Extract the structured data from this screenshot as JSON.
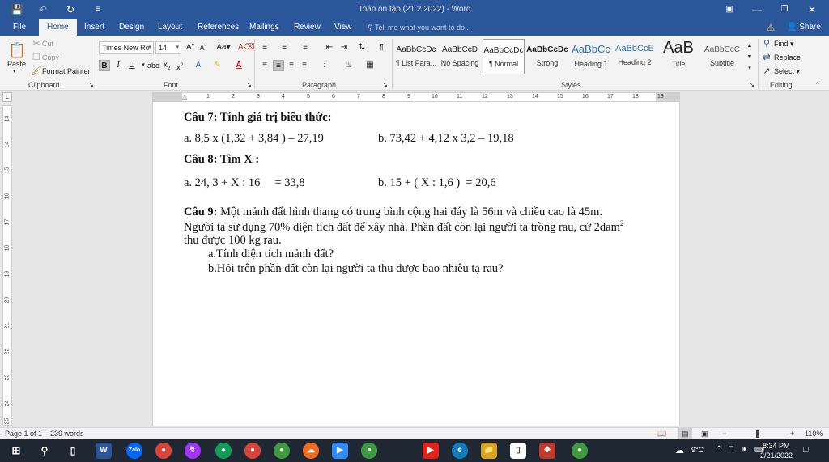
{
  "titlebar": {
    "doc_title": "Toán ôn tập (21.2.2022) - Word",
    "save_icon": "save-icon",
    "undo_icon": "undo-icon",
    "redo_icon": "redo-icon"
  },
  "tabs": [
    {
      "label": "File"
    },
    {
      "label": "Home"
    },
    {
      "label": "Insert"
    },
    {
      "label": "Design"
    },
    {
      "label": "Layout"
    },
    {
      "label": "References"
    },
    {
      "label": "Mailings"
    },
    {
      "label": "Review"
    },
    {
      "label": "View"
    }
  ],
  "tell_me": "Tell me what you want to do...",
  "share_label": "Share",
  "clipboard": {
    "paste": "Paste",
    "cut": "Cut",
    "copy": "Copy",
    "format_painter": "Format Painter",
    "label": "Clipboard"
  },
  "font": {
    "name": "Times New Ro",
    "size": "14",
    "label": "Font"
  },
  "paragraph": {
    "label": "Paragraph"
  },
  "styles": {
    "label": "Styles",
    "items": [
      {
        "preview": "AaBbCcDc",
        "name": "¶ List Para..."
      },
      {
        "preview": "AaBbCcD",
        "name": "No Spacing"
      },
      {
        "preview": "AaBbCcDc",
        "name": "¶ Normal"
      },
      {
        "preview": "AaBbCcDc",
        "name": "Strong"
      },
      {
        "preview": "AaBbCc",
        "name": "Heading 1"
      },
      {
        "preview": "AaBbCcE",
        "name": "Heading 2"
      },
      {
        "preview": "AaB",
        "name": "Title"
      },
      {
        "preview": "AaBbCcC",
        "name": "Subtitle"
      }
    ]
  },
  "editing": {
    "find": "Find",
    "replace": "Replace",
    "select": "Select",
    "label": "Editing"
  },
  "ruler_h": [
    "1",
    "2",
    "3",
    "4",
    "5",
    "6",
    "7",
    "8",
    "9",
    "10",
    "11",
    "12",
    "13",
    "14",
    "15",
    "16",
    "17",
    "18",
    "19"
  ],
  "ruler_v": [
    "13",
    "14",
    "15",
    "16",
    "17",
    "18",
    "19",
    "20",
    "21",
    "22",
    "23",
    "24",
    "25"
  ],
  "document": {
    "q7_title": "Câu 7: Tính giá trị biểu thức:",
    "q7_a": "a. 8,5 x (1,32 + 3,84 ) – 27,19",
    "q7_b": "b. 73,42 + 4,12 x 3,2 – 19,18",
    "q8_title": "Câu 8: Tìm X :",
    "q8_a": "a. 24, 3 + X : 16     = 33,8",
    "q8_b": "b. 15 + ( X : 1,6 )  = 20,6",
    "q9_label": "Câu 9:",
    "q9_line1": " Một mảnh đất hình thang có trung bình cộng hai đáy là 56m và chiều cao là 45m.",
    "q9_line2": "Người ta sử dụng 70% diện tích đất để xây nhà. Phần đất còn lại người ta trồng rau, cứ 2dam",
    "q9_sup": "2",
    "q9_line3": "thu được 100 kg rau.",
    "q9_a": "a.Tính diện tích mảnh đất?",
    "q9_b": "b.Hỏi trên phần đất còn lại người ta thu được bao nhiêu tạ rau?"
  },
  "status": {
    "page": "Page 1 of 1",
    "words": "239 words",
    "zoom": "110%"
  },
  "taskbar": {
    "weather": "9°C",
    "time": "8:34 PM",
    "date": "2/21/2022"
  },
  "colors": {
    "word_blue": "#2b579a",
    "ribbon_bg": "#f3f3f3",
    "taskbar_bg": "#1f2733"
  }
}
